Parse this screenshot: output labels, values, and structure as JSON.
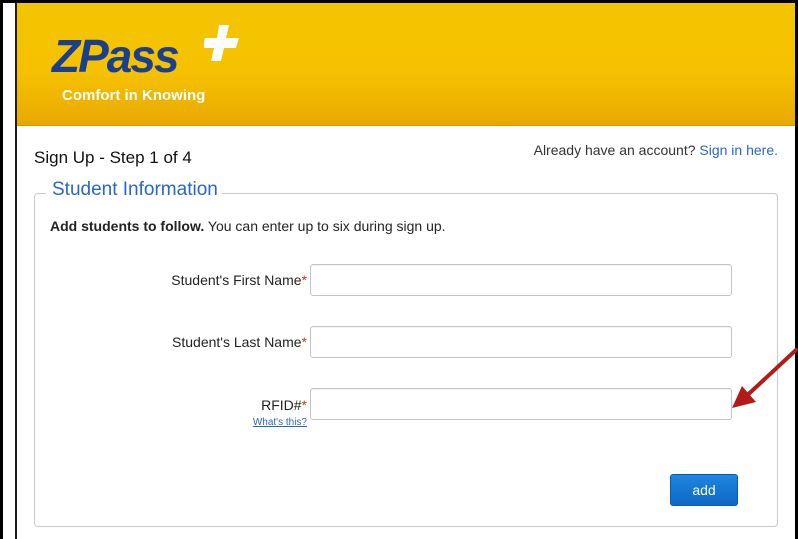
{
  "brand": {
    "logo_text": "ZPass",
    "tagline": "Comfort in Knowing"
  },
  "page": {
    "title": "Sign Up - Step 1 of 4",
    "account_prompt": "Already have an account?",
    "sign_in_link": "Sign in here."
  },
  "section": {
    "legend": "Student Information",
    "intro_bold": "Add students to follow.",
    "intro_rest": " You can enter up to six during sign up."
  },
  "fields": {
    "first_name": {
      "label": "Student's First Name",
      "required_mark": "*",
      "value": ""
    },
    "last_name": {
      "label": "Student's Last Name",
      "required_mark": "*",
      "value": ""
    },
    "rfid": {
      "label": "RFID#",
      "required_mark": "*",
      "help_link": "What's this?",
      "value": ""
    }
  },
  "actions": {
    "add_label": "add"
  },
  "colors": {
    "header_yellow": "#f6c200",
    "logo_blue": "#1b3f8f",
    "link_blue": "#2a66c9",
    "button_blue": "#1f86e0",
    "required_red": "#c0392b",
    "annotation_arrow": "#b31b1b"
  },
  "icons": {
    "logo_plus": "plus-icon",
    "annotation": "arrow-icon"
  }
}
